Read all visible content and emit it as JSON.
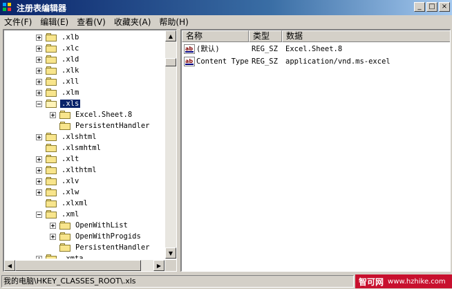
{
  "window": {
    "title": "注册表编辑器",
    "buttons": {
      "minimize": "_",
      "maximize": "□",
      "close": "×"
    }
  },
  "menu": [
    {
      "label": "文件(F)"
    },
    {
      "label": "编辑(E)"
    },
    {
      "label": "查看(V)"
    },
    {
      "label": "收藏夹(A)"
    },
    {
      "label": "帮助(H)"
    }
  ],
  "tree": [
    {
      "label": ".xlb",
      "depth": 0,
      "expander": "plus",
      "open": false,
      "selected": false
    },
    {
      "label": ".xlc",
      "depth": 0,
      "expander": "plus",
      "open": false,
      "selected": false
    },
    {
      "label": ".xld",
      "depth": 0,
      "expander": "plus",
      "open": false,
      "selected": false
    },
    {
      "label": ".xlk",
      "depth": 0,
      "expander": "plus",
      "open": false,
      "selected": false
    },
    {
      "label": ".xll",
      "depth": 0,
      "expander": "plus",
      "open": false,
      "selected": false
    },
    {
      "label": ".xlm",
      "depth": 0,
      "expander": "plus",
      "open": false,
      "selected": false
    },
    {
      "label": ".xls",
      "depth": 0,
      "expander": "minus",
      "open": true,
      "selected": true
    },
    {
      "label": "Excel.Sheet.8",
      "depth": 1,
      "expander": "plus",
      "open": false,
      "selected": false
    },
    {
      "label": "PersistentHandler",
      "depth": 1,
      "expander": "none",
      "open": false,
      "selected": false
    },
    {
      "label": ".xlshtml",
      "depth": 0,
      "expander": "plus",
      "open": false,
      "selected": false
    },
    {
      "label": ".xlsmhtml",
      "depth": 0,
      "expander": "none",
      "open": false,
      "selected": false
    },
    {
      "label": ".xlt",
      "depth": 0,
      "expander": "plus",
      "open": false,
      "selected": false
    },
    {
      "label": ".xlthtml",
      "depth": 0,
      "expander": "plus",
      "open": false,
      "selected": false
    },
    {
      "label": ".xlv",
      "depth": 0,
      "expander": "plus",
      "open": false,
      "selected": false
    },
    {
      "label": ".xlw",
      "depth": 0,
      "expander": "plus",
      "open": false,
      "selected": false
    },
    {
      "label": ".xlxml",
      "depth": 0,
      "expander": "none",
      "open": false,
      "selected": false
    },
    {
      "label": ".xml",
      "depth": 0,
      "expander": "minus",
      "open": false,
      "selected": false
    },
    {
      "label": "OpenWithList",
      "depth": 1,
      "expander": "plus",
      "open": false,
      "selected": false
    },
    {
      "label": "OpenWithProgids",
      "depth": 1,
      "expander": "plus",
      "open": false,
      "selected": false
    },
    {
      "label": "PersistentHandler",
      "depth": 1,
      "expander": "none",
      "open": false,
      "selected": false
    },
    {
      "label": ".xmta",
      "depth": 0,
      "expander": "plus",
      "open": false,
      "selected": false
    }
  ],
  "list": {
    "columns": [
      "名称",
      "类型",
      "数据"
    ],
    "rows": [
      {
        "name": "(默认)",
        "type": "REG_SZ",
        "data": "Excel.Sheet.8",
        "icon": "string-value-icon"
      },
      {
        "name": "Content Type",
        "type": "REG_SZ",
        "data": "application/vnd.ms-excel",
        "icon": "string-value-icon"
      }
    ]
  },
  "status": {
    "path": "我的电脑\\HKEY_CLASSES_ROOT\\.xls"
  },
  "watermark": {
    "name": "智可网",
    "url": "www.hzhike.com"
  },
  "colors": {
    "selection": "#0a246a",
    "folder": "#f8e58c",
    "watermark_bg": "#c8102e"
  }
}
